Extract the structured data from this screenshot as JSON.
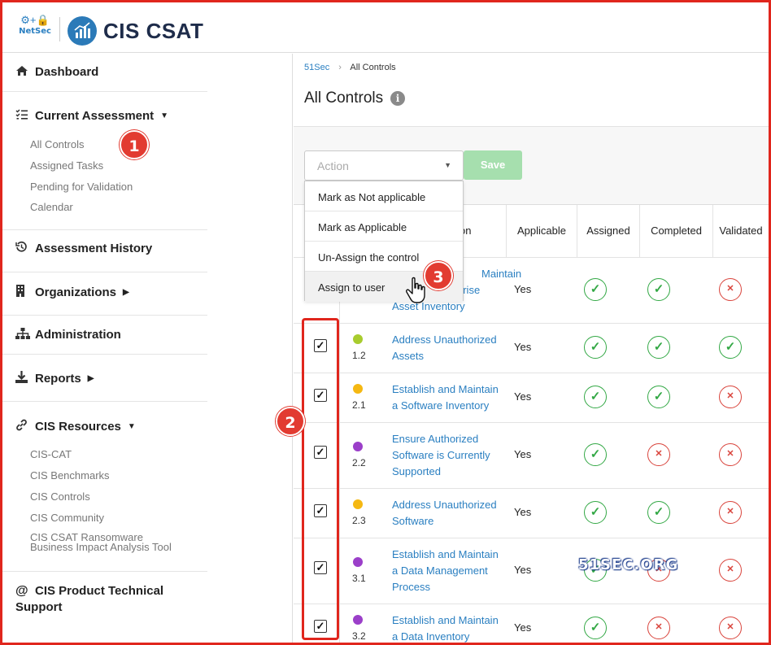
{
  "header": {
    "netsec_glyphs": "⚙+🔒",
    "netsec_label": "NetSec",
    "app_name": "CIS CSAT"
  },
  "sidebar": {
    "dashboard": "Dashboard",
    "current_assessment": "Current Assessment",
    "current_items": [
      "All Controls",
      "Assigned Tasks",
      "Pending for Validation",
      "Calendar"
    ],
    "assessment_history": "Assessment History",
    "organizations": "Organizations",
    "administration": "Administration",
    "reports": "Reports",
    "cis_resources": "CIS Resources",
    "resource_items": [
      "CIS-CAT",
      "CIS Benchmarks",
      "CIS Controls",
      "CIS Community",
      "CIS CSAT Ransomware",
      "Business Impact Analysis Tool"
    ],
    "support_line1": "CIS Product Technical",
    "support_line2": "Support"
  },
  "breadcrumb": {
    "home": "51Sec",
    "current": "All Controls"
  },
  "page": {
    "title": "All Controls"
  },
  "action": {
    "placeholder": "Action",
    "save": "Save",
    "options": [
      "Mark as Not applicable",
      "Mark as Applicable",
      "Un-Assign the control",
      "Assign to user"
    ]
  },
  "table": {
    "headers": {
      "title": "on",
      "applicable": "Applicable",
      "assigned": "Assigned",
      "completed": "Completed",
      "validated": "Validated"
    },
    "rows": [
      {
        "id": "",
        "title_lines": [
          "Maintain",
          "prise",
          "Asset Inventory"
        ],
        "applicable": "Yes",
        "assigned": "ok",
        "completed": "ok",
        "validated": "no",
        "dot": ""
      },
      {
        "id": "1.2",
        "title_lines": [
          "Address Unauthorized",
          "Assets"
        ],
        "applicable": "Yes",
        "assigned": "ok",
        "completed": "ok",
        "validated": "ok",
        "dot": "#a8cc2e"
      },
      {
        "id": "2.1",
        "title_lines": [
          "Establish and Maintain",
          "a Software Inventory"
        ],
        "applicable": "Yes",
        "assigned": "ok",
        "completed": "ok",
        "validated": "no",
        "dot": "#f5b812"
      },
      {
        "id": "2.2",
        "title_lines": [
          "Ensure Authorized",
          "Software is Currently",
          "Supported"
        ],
        "applicable": "Yes",
        "assigned": "ok",
        "completed": "no",
        "validated": "no",
        "dot": "#9b3fc9"
      },
      {
        "id": "2.3",
        "title_lines": [
          "Address Unauthorized",
          "Software"
        ],
        "applicable": "Yes",
        "assigned": "ok",
        "completed": "ok",
        "validated": "no",
        "dot": "#f5b812"
      },
      {
        "id": "3.1",
        "title_lines": [
          "Establish and Maintain",
          "a Data Management",
          "Process"
        ],
        "applicable": "Yes",
        "assigned": "ok",
        "completed": "no",
        "validated": "no",
        "dot": "#9b3fc9"
      },
      {
        "id": "3.2",
        "title_lines": [
          "Establish and Maintain",
          "a Data Inventory"
        ],
        "applicable": "Yes",
        "assigned": "ok",
        "completed": "no",
        "validated": "no",
        "dot": "#9b3fc9"
      }
    ]
  },
  "watermark": "51SEC.ORG",
  "annotations": [
    "1",
    "2",
    "3"
  ],
  "colors": {
    "accent": "#2a7fc1",
    "ok": "#33a845",
    "error": "#d9443c",
    "annotation": "#e0261d",
    "save_disabled": "#a6dfae"
  },
  "icons": {
    "ok": "✓",
    "no": "✕"
  }
}
